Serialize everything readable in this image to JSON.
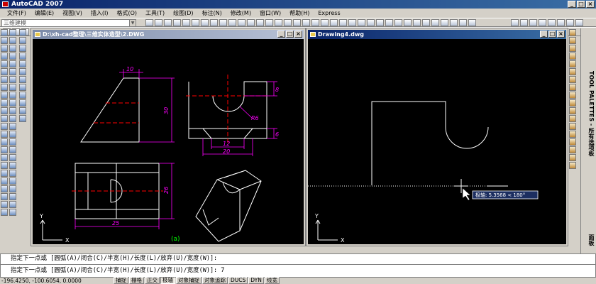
{
  "app": {
    "title": "AutoCAD 2007"
  },
  "menu": [
    "文件(F)",
    "编辑(E)",
    "视图(V)",
    "插入(I)",
    "格式(O)",
    "工具(T)",
    "绘图(D)",
    "标注(N)",
    "修改(M)",
    "窗口(W)",
    "帮助(H)",
    "Express"
  ],
  "toolbar": {
    "workspace": "三维建模"
  },
  "windows": {
    "left": {
      "title": "D:\\xh-cad整理\\三维实体造型\\2.DWG",
      "axis_y": "Y",
      "axis_x": "X"
    },
    "right": {
      "title": "Drawing4.dwg",
      "axis_y": "Y",
      "axis_x": "X"
    }
  },
  "drawing": {
    "dims": {
      "d10": "10",
      "d30": "30",
      "d8": "8",
      "r6": "R6",
      "d12": "12",
      "d20": "20",
      "d6": "6",
      "d26": "26",
      "d25": "25"
    },
    "caption": "(a)"
  },
  "tooltip": {
    "text": "极轴: 5.3568 < 180°"
  },
  "palette": {
    "title": "TOOL PALETTES - 所有选项板",
    "tab": "面板"
  },
  "command": {
    "line1": "指定下一点或 [圆弧(A)/闭合(C)/半宽(H)/长度(L)/放弃(U)/宽度(W)]:",
    "line2": "指定下一点或 [圆弧(A)/闭合(C)/半宽(H)/长度(L)/放弃(U)/宽度(W)]: 7"
  },
  "status": {
    "coords": "-196.4250, -100.6054, 0.0000",
    "buttons": [
      {
        "label": "捕捉",
        "on": false
      },
      {
        "label": "栅格",
        "on": false
      },
      {
        "label": "正交",
        "on": false
      },
      {
        "label": "极轴",
        "on": true
      },
      {
        "label": "对象捕捉",
        "on": false
      },
      {
        "label": "对象追踪",
        "on": false
      },
      {
        "label": "DUCS",
        "on": false
      },
      {
        "label": "DYN",
        "on": false
      },
      {
        "label": "线宽",
        "on": false
      }
    ]
  },
  "colors": {
    "dim": "#ff00ff",
    "line": "#ffffff",
    "center": "#ff0000",
    "tooltip_bg": "#1c2e60"
  }
}
